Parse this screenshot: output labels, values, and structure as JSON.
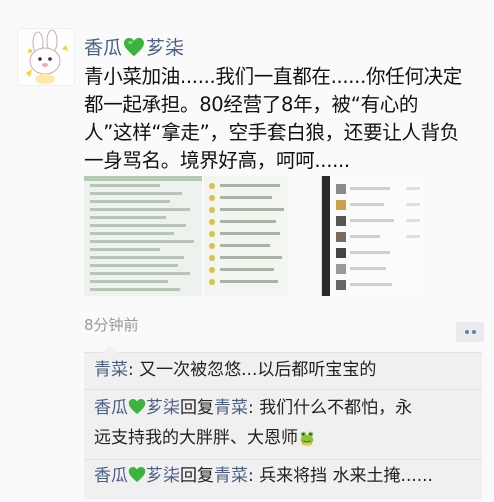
{
  "post": {
    "author_a": "香瓜",
    "author_b": "芗柒",
    "text_line1": "青小菜加油......我们一直都在......你任何决定",
    "text_line2": "都一起承担。80经营了8年，被“有心的",
    "text_line3": "人”这样“拿走”，空手套白狼，还要让人背负",
    "text_line4": "一身骂名。境界好高，呵呵......",
    "time": "8分钟前"
  },
  "comments": {
    "c1_author": "青菜",
    "c1_text": ": 又一次被忽悠...以后都听宝宝的",
    "c2_author_a": "香瓜",
    "c2_author_b": "芗柒",
    "c2_reply_word": "回复",
    "c2_reply_to": "青菜",
    "c2_text_l1": ": 我们什么不都怕，永",
    "c2_text_l2": "远支持我的大胖胖、大恩师",
    "c3_author_a": "香瓜",
    "c3_author_b": "芗柒",
    "c3_reply_word": "回复",
    "c3_reply_to": "青菜",
    "c3_text": ": 兵来将挡 水来土掩......"
  },
  "colors": {
    "name_blue": "#4a5f86",
    "heart_green": "#3cb43c"
  },
  "icons": {
    "avatar": "cartoon-bunny-avatar",
    "heart": "green-heart-icon",
    "comment": "more-comment-icon",
    "frog": "frog-emoji-icon"
  }
}
